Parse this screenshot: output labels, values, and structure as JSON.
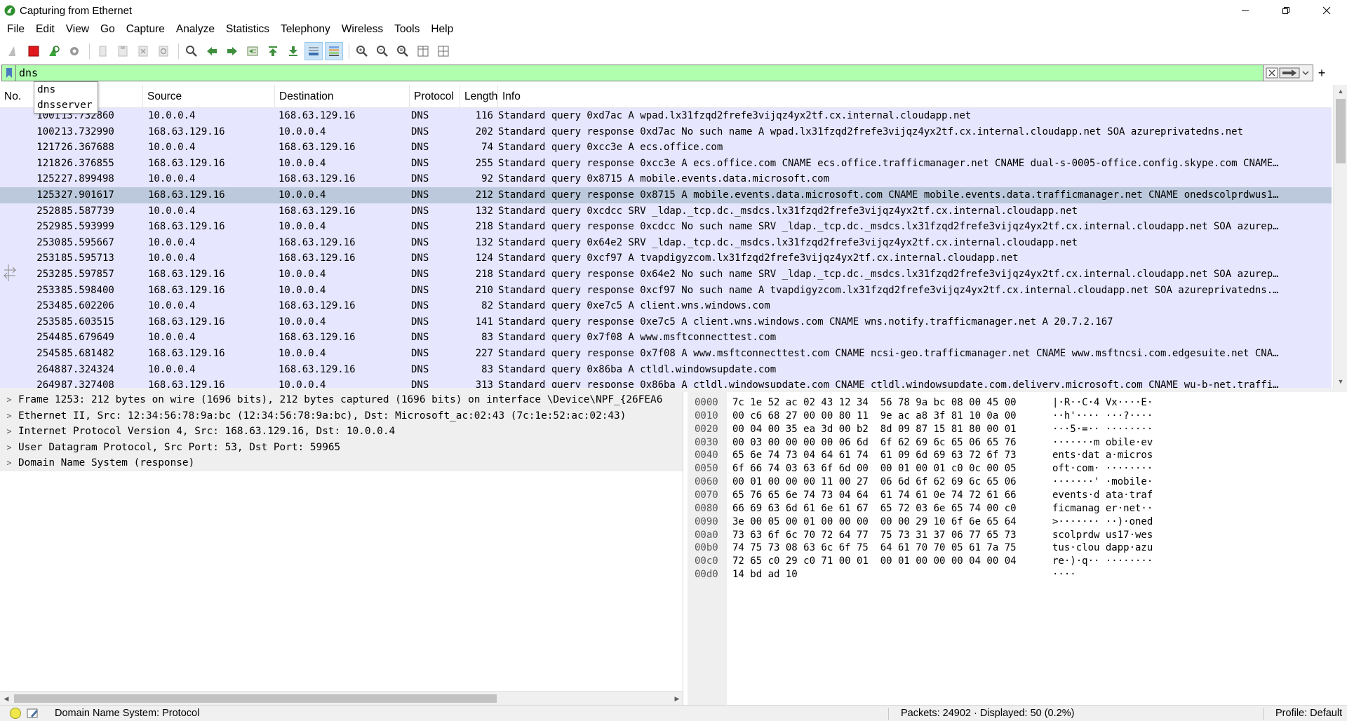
{
  "window": {
    "title": "Capturing from Ethernet",
    "accent": "#2c8f2c"
  },
  "menu": [
    "File",
    "Edit",
    "View",
    "Go",
    "Capture",
    "Analyze",
    "Statistics",
    "Telephony",
    "Wireless",
    "Tools",
    "Help"
  ],
  "toolbar": {
    "icons": [
      "shark-fin-start-icon",
      "stop-capture-icon",
      "restart-capture-icon",
      "capture-options-icon",
      "open-file-icon",
      "save-file-icon",
      "close-file-icon",
      "reload-file-icon",
      "find-packet-icon",
      "go-back-icon",
      "go-forward-icon",
      "go-to-packet-icon",
      "go-first-icon",
      "go-last-icon",
      "auto-scroll-icon",
      "colorize-icon",
      "zoom-in-icon",
      "zoom-out-icon",
      "zoom-normal-icon",
      "resize-columns-icon",
      "layout-icon"
    ]
  },
  "filter": {
    "value": "dns",
    "bg_color": "#afffaf",
    "suggestions": [
      "dns",
      "dnsserver"
    ]
  },
  "packet_list": {
    "columns": [
      "No.",
      "Source",
      "Destination",
      "Protocol",
      "Length",
      "Info"
    ],
    "row_color": "#e7e6ff",
    "selected_color": "#bcc9dc",
    "rows": [
      {
        "no": "1001",
        "time": "13.732860",
        "src": "10.0.0.4",
        "dst": "168.63.129.16",
        "proto": "DNS",
        "len": "116",
        "info": "Standard query 0xd7ac A wpad.lx31fzqd2frefe3vijqz4yx2tf.cx.internal.cloudapp.net"
      },
      {
        "no": "1002",
        "time": "13.732990",
        "src": "168.63.129.16",
        "dst": "10.0.0.4",
        "proto": "DNS",
        "len": "202",
        "info": "Standard query response 0xd7ac No such name A wpad.lx31fzqd2frefe3vijqz4yx2tf.cx.internal.cloudapp.net SOA azureprivatedns.net"
      },
      {
        "no": "1217",
        "time": "26.367688",
        "src": "10.0.0.4",
        "dst": "168.63.129.16",
        "proto": "DNS",
        "len": "74",
        "info": "Standard query 0xcc3e A ecs.office.com"
      },
      {
        "no": "1218",
        "time": "26.376855",
        "src": "168.63.129.16",
        "dst": "10.0.0.4",
        "proto": "DNS",
        "len": "255",
        "info": "Standard query response 0xcc3e A ecs.office.com CNAME ecs.office.trafficmanager.net CNAME dual-s-0005-office.config.skype.com CNAME…"
      },
      {
        "no": "1252",
        "time": "27.899498",
        "src": "10.0.0.4",
        "dst": "168.63.129.16",
        "proto": "DNS",
        "len": "92",
        "info": "Standard query 0x8715 A mobile.events.data.microsoft.com"
      },
      {
        "no": "1253",
        "time": "27.901617",
        "src": "168.63.129.16",
        "dst": "10.0.0.4",
        "proto": "DNS",
        "len": "212",
        "info": "Standard query response 0x8715 A mobile.events.data.microsoft.com CNAME mobile.events.data.trafficmanager.net CNAME onedscolprdwus1…",
        "selected": true
      },
      {
        "no": "2528",
        "time": "85.587739",
        "src": "10.0.0.4",
        "dst": "168.63.129.16",
        "proto": "DNS",
        "len": "132",
        "info": "Standard query 0xcdcc SRV _ldap._tcp.dc._msdcs.lx31fzqd2frefe3vijqz4yx2tf.cx.internal.cloudapp.net"
      },
      {
        "no": "2529",
        "time": "85.593999",
        "src": "168.63.129.16",
        "dst": "10.0.0.4",
        "proto": "DNS",
        "len": "218",
        "info": "Standard query response 0xcdcc No such name SRV _ldap._tcp.dc._msdcs.lx31fzqd2frefe3vijqz4yx2tf.cx.internal.cloudapp.net SOA azurep…"
      },
      {
        "no": "2530",
        "time": "85.595667",
        "src": "10.0.0.4",
        "dst": "168.63.129.16",
        "proto": "DNS",
        "len": "132",
        "info": "Standard query 0x64e2 SRV _ldap._tcp.dc._msdcs.lx31fzqd2frefe3vijqz4yx2tf.cx.internal.cloudapp.net"
      },
      {
        "no": "2531",
        "time": "85.595713",
        "src": "10.0.0.4",
        "dst": "168.63.129.16",
        "proto": "DNS",
        "len": "124",
        "info": "Standard query 0xcf97 A tvapdigyzcom.lx31fzqd2frefe3vijqz4yx2tf.cx.internal.cloudapp.net"
      },
      {
        "no": "2532",
        "time": "85.597857",
        "src": "168.63.129.16",
        "dst": "10.0.0.4",
        "proto": "DNS",
        "len": "218",
        "info": "Standard query response 0x64e2 No such name SRV _ldap._tcp.dc._msdcs.lx31fzqd2frefe3vijqz4yx2tf.cx.internal.cloudapp.net SOA azurep…"
      },
      {
        "no": "2533",
        "time": "85.598400",
        "src": "168.63.129.16",
        "dst": "10.0.0.4",
        "proto": "DNS",
        "len": "210",
        "info": "Standard query response 0xcf97 No such name A tvapdigyzcom.lx31fzqd2frefe3vijqz4yx2tf.cx.internal.cloudapp.net SOA azureprivatedns.…"
      },
      {
        "no": "2534",
        "time": "85.602206",
        "src": "10.0.0.4",
        "dst": "168.63.129.16",
        "proto": "DNS",
        "len": "82",
        "info": "Standard query 0xe7c5 A client.wns.windows.com"
      },
      {
        "no": "2535",
        "time": "85.603515",
        "src": "168.63.129.16",
        "dst": "10.0.0.4",
        "proto": "DNS",
        "len": "141",
        "info": "Standard query response 0xe7c5 A client.wns.windows.com CNAME wns.notify.trafficmanager.net A 20.7.2.167"
      },
      {
        "no": "2544",
        "time": "85.679649",
        "src": "10.0.0.4",
        "dst": "168.63.129.16",
        "proto": "DNS",
        "len": "83",
        "info": "Standard query 0x7f08 A www.msftconnecttest.com"
      },
      {
        "no": "2545",
        "time": "85.681482",
        "src": "168.63.129.16",
        "dst": "10.0.0.4",
        "proto": "DNS",
        "len": "227",
        "info": "Standard query response 0x7f08 A www.msftconnecttest.com CNAME ncsi-geo.trafficmanager.net CNAME www.msftncsi.com.edgesuite.net CNA…"
      },
      {
        "no": "2648",
        "time": "87.324324",
        "src": "10.0.0.4",
        "dst": "168.63.129.16",
        "proto": "DNS",
        "len": "83",
        "info": "Standard query 0x86ba A ctldl.windowsupdate.com"
      },
      {
        "no": "2649",
        "time": "87.327408",
        "src": "168.63.129.16",
        "dst": "10.0.0.4",
        "proto": "DNS",
        "len": "313",
        "info": "Standard query response 0x86ba A ctldl.windowsupdate.com CNAME ctldl.windowsupdate.com.delivery.microsoft.com CNAME wu-b-net.traffi…"
      }
    ]
  },
  "details": [
    "Frame 1253: 212 bytes on wire (1696 bits), 212 bytes captured (1696 bits) on interface \\Device\\NPF_{26FEA6",
    "Ethernet II, Src: 12:34:56:78:9a:bc (12:34:56:78:9a:bc), Dst: Microsoft_ac:02:43 (7c:1e:52:ac:02:43)",
    "Internet Protocol Version 4, Src: 168.63.129.16, Dst: 10.0.0.4",
    "User Datagram Protocol, Src Port: 53, Dst Port: 59965",
    "Domain Name System (response)"
  ],
  "bytes": [
    {
      "off": "0000",
      "hex": "7c 1e 52 ac 02 43 12 34  56 78 9a bc 08 00 45 00",
      "ascii": "|·R··C·4 Vx····E·"
    },
    {
      "off": "0010",
      "hex": "00 c6 68 27 00 00 80 11  9e ac a8 3f 81 10 0a 00",
      "ascii": "··h'···· ···?····"
    },
    {
      "off": "0020",
      "hex": "00 04 00 35 ea 3d 00 b2  8d 09 87 15 81 80 00 01",
      "ascii": "···5·=·· ········"
    },
    {
      "off": "0030",
      "hex": "00 03 00 00 00 00 06 6d  6f 62 69 6c 65 06 65 76",
      "ascii": "·······m obile·ev"
    },
    {
      "off": "0040",
      "hex": "65 6e 74 73 04 64 61 74  61 09 6d 69 63 72 6f 73",
      "ascii": "ents·dat a·micros"
    },
    {
      "off": "0050",
      "hex": "6f 66 74 03 63 6f 6d 00  00 01 00 01 c0 0c 00 05",
      "ascii": "oft·com· ········"
    },
    {
      "off": "0060",
      "hex": "00 01 00 00 00 11 00 27  06 6d 6f 62 69 6c 65 06",
      "ascii": "·······' ·mobile·"
    },
    {
      "off": "0070",
      "hex": "65 76 65 6e 74 73 04 64  61 74 61 0e 74 72 61 66",
      "ascii": "events·d ata·traf"
    },
    {
      "off": "0080",
      "hex": "66 69 63 6d 61 6e 61 67  65 72 03 6e 65 74 00 c0",
      "ascii": "ficmanag er·net··"
    },
    {
      "off": "0090",
      "hex": "3e 00 05 00 01 00 00 00  00 00 29 10 6f 6e 65 64",
      "ascii": ">······· ··)·oned"
    },
    {
      "off": "00a0",
      "hex": "73 63 6f 6c 70 72 64 77  75 73 31 37 06 77 65 73",
      "ascii": "scolprdw us17·wes"
    },
    {
      "off": "00b0",
      "hex": "74 75 73 08 63 6c 6f 75  64 61 70 70 05 61 7a 75",
      "ascii": "tus·clou dapp·azu"
    },
    {
      "off": "00c0",
      "hex": "72 65 c0 29 c0 71 00 01  00 01 00 00 00 04 00 04",
      "ascii": "re·)·q·· ········"
    },
    {
      "off": "00d0",
      "hex": "14 bd ad 10",
      "ascii": "····"
    }
  ],
  "status": {
    "field": "Domain Name System: Protocol",
    "packets": "Packets: 24902 · Displayed: 50 (0.2%)",
    "profile": "Profile: Default"
  }
}
